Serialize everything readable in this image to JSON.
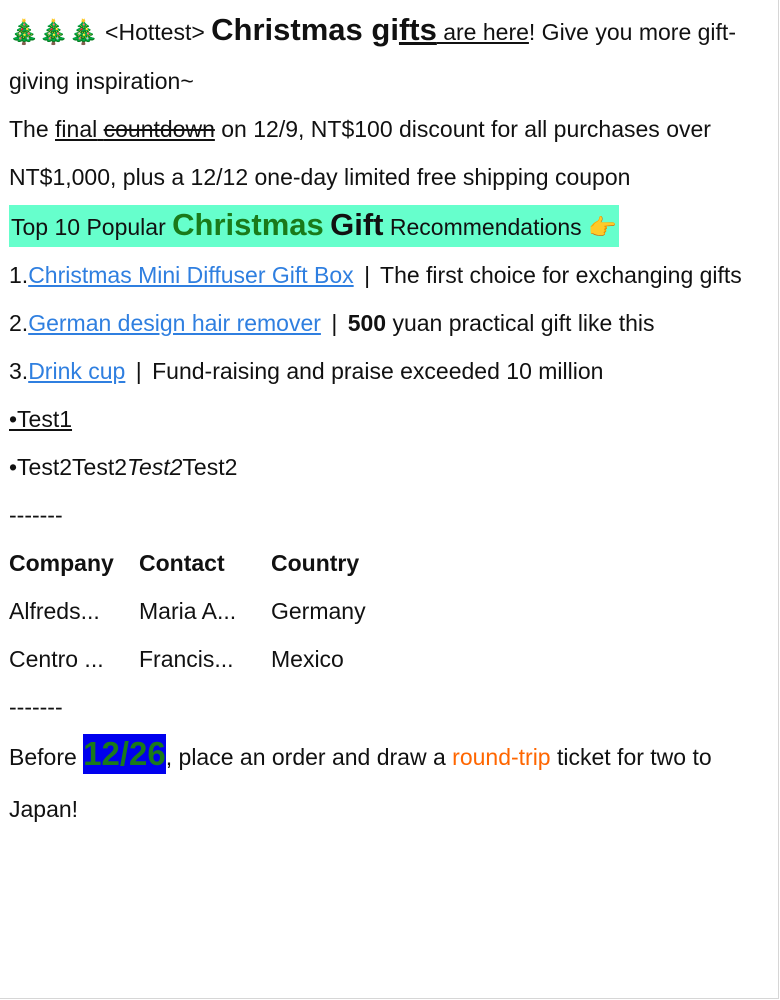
{
  "header": {
    "emoji": "🎄🎄🎄",
    "prefix": " <Hottest> ",
    "big1": "Christmas gi",
    "big2": "fts",
    "mid": " are here",
    "tail": "! Give you more gift-giving inspiration~"
  },
  "notice": {
    "part1": "The ",
    "final": "final",
    "space": " ",
    "countdown": "countdown",
    "part2": " on 12/9, NT$100 discount for all purchases over NT$1,000, plus a 12/12 one-day limited free shipping coupon"
  },
  "top10": {
    "prefix": "Top 10 Popular ",
    "green": "Christmas",
    "space": " ",
    "gift": "Gift",
    "suffix": " Recommendations ",
    "hand": "👉"
  },
  "items": [
    {
      "num": "1.",
      "link": "Christmas Mini Diffuser Gift Box",
      "sep": "|",
      "desc": " The first choice for exchanging gifts"
    },
    {
      "num": "2.",
      "link": "German design hair remover",
      "sep": "|",
      "bold": "500",
      "desc": " yuan practical gift like this"
    },
    {
      "num": "3.",
      "link": "Drink cup",
      "sep": "|",
      "desc": " Fund-raising and praise exceeded 10 million"
    }
  ],
  "tests": {
    "t1": "•Test1",
    "t2a": "•Test2Test2",
    "t2b": "Test2",
    "t2c": "Test2"
  },
  "divider": "-------",
  "table": {
    "headers": [
      "Company",
      "Contact",
      "Country"
    ],
    "rows": [
      [
        "Alfreds...",
        "Maria A...",
        "Germany"
      ],
      [
        "Centro ...",
        "Francis...",
        "Mexico"
      ]
    ]
  },
  "promo": {
    "before": "Before ",
    "date": "12/26",
    "mid": ", place an order and draw a ",
    "orange": "round-trip",
    "end": " ticket for two to Japan!"
  },
  "colors": {
    "highlight_bg": "#66ffcc",
    "green": "#1a7a1a",
    "link": "#2f7fe0",
    "date_bg": "#0000ee",
    "orange": "#ff6600"
  }
}
